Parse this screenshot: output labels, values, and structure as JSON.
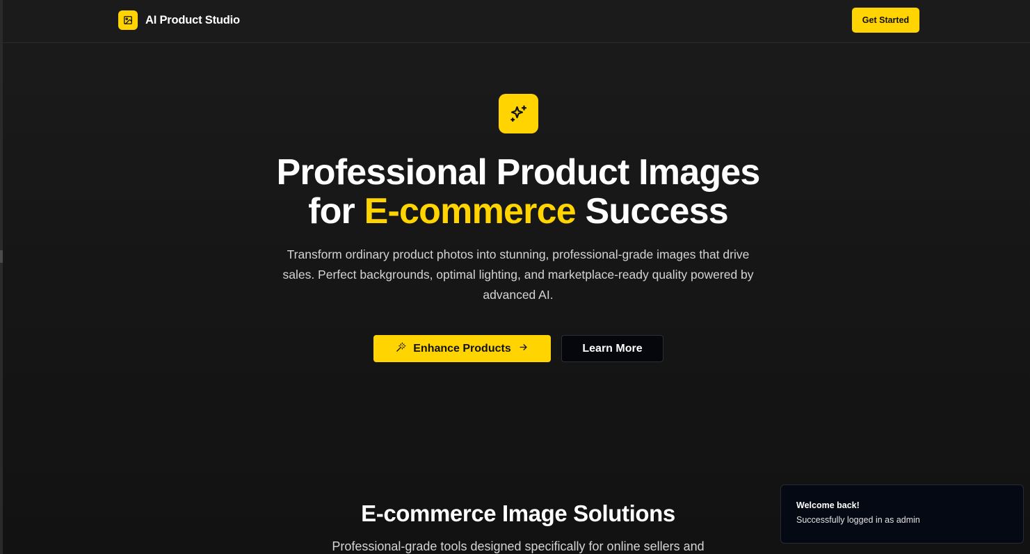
{
  "header": {
    "brand_name": "AI Product Studio",
    "brand_icon": "image-icon",
    "cta_label": "Get Started"
  },
  "hero": {
    "icon": "sparkles-icon",
    "title_line1": "Professional Product Images",
    "title_line2_prefix": "for",
    "title_line2_accent": "E-commerce",
    "title_line2_suffix": "Success",
    "subtitle": "Transform ordinary product photos into stunning, professional-grade images that drive sales. Perfect backgrounds, optimal lighting, and marketplace-ready quality powered by advanced AI.",
    "primary_button": "Enhance Products",
    "primary_button_icon": "magic-wand-icon",
    "primary_button_trailing_icon": "arrow-right-icon",
    "secondary_button": "Learn More"
  },
  "solutions": {
    "title": "E-commerce Image Solutions",
    "subtitle": "Professional-grade tools designed specifically for online sellers and"
  },
  "toast": {
    "title": "Welcome back!",
    "message": "Successfully logged in as admin"
  },
  "colors": {
    "accent": "#ffd400",
    "background": "#141414",
    "toast_background": "#050914"
  }
}
